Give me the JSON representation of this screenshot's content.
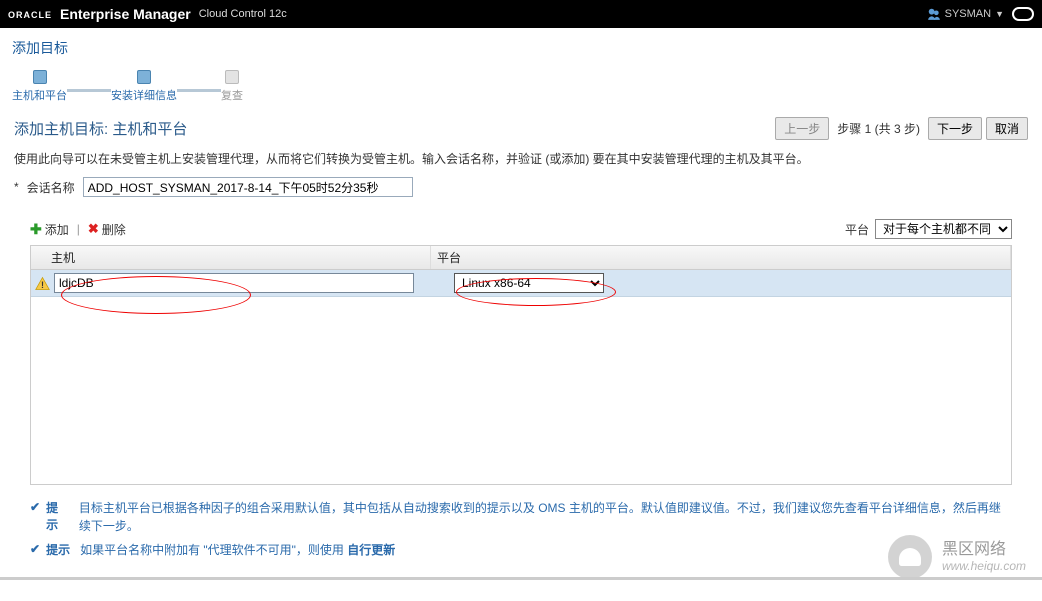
{
  "header": {
    "brand": "ORACLE",
    "title": "Enterprise Manager",
    "subtitle": "Cloud Control 12c",
    "user": "SYSMAN"
  },
  "page_title": "添加目标",
  "wizard": {
    "step1": "主机和平台",
    "step2": "安装详细信息",
    "step3": "复查"
  },
  "section": {
    "title": "添加主机目标: 主机和平台",
    "prev": "上一步",
    "step_text": "步骤 1 (共 3 步)",
    "next": "下一步",
    "cancel": "取消"
  },
  "description": "使用此向导可以在未受管主机上安装管理代理，从而将它们转换为受管主机。输入会话名称，并验证 (或添加) 要在其中安装管理代理的主机及其平台。",
  "form": {
    "session_label": "会话名称",
    "session_value": "ADD_HOST_SYSMAN_2017-8-14_下午05时52分35秒"
  },
  "toolbar": {
    "add": "添加",
    "delete": "删除",
    "platform_label": "平台",
    "platform_value": "对于每个主机都不同"
  },
  "table": {
    "col_host": "主机",
    "col_platform": "平台",
    "row1_host": "ldjcDB",
    "row1_platform": "Linux x86-64"
  },
  "hints": {
    "label": "提示",
    "hint1": "目标主机平台已根据各种因子的组合采用默认值，其中包括从自动搜索收到的提示以及 OMS 主机的平台。默认值即建议值。不过，我们建议您先查看平台详细信息，然后再继续下一步。",
    "hint2_prefix": "如果平台名称中附加有 \"代理软件不可用\"，则使用 ",
    "hint2_link": "自行更新"
  },
  "watermark": {
    "line1": "黑区网络",
    "url": "www.heiqu.com"
  }
}
